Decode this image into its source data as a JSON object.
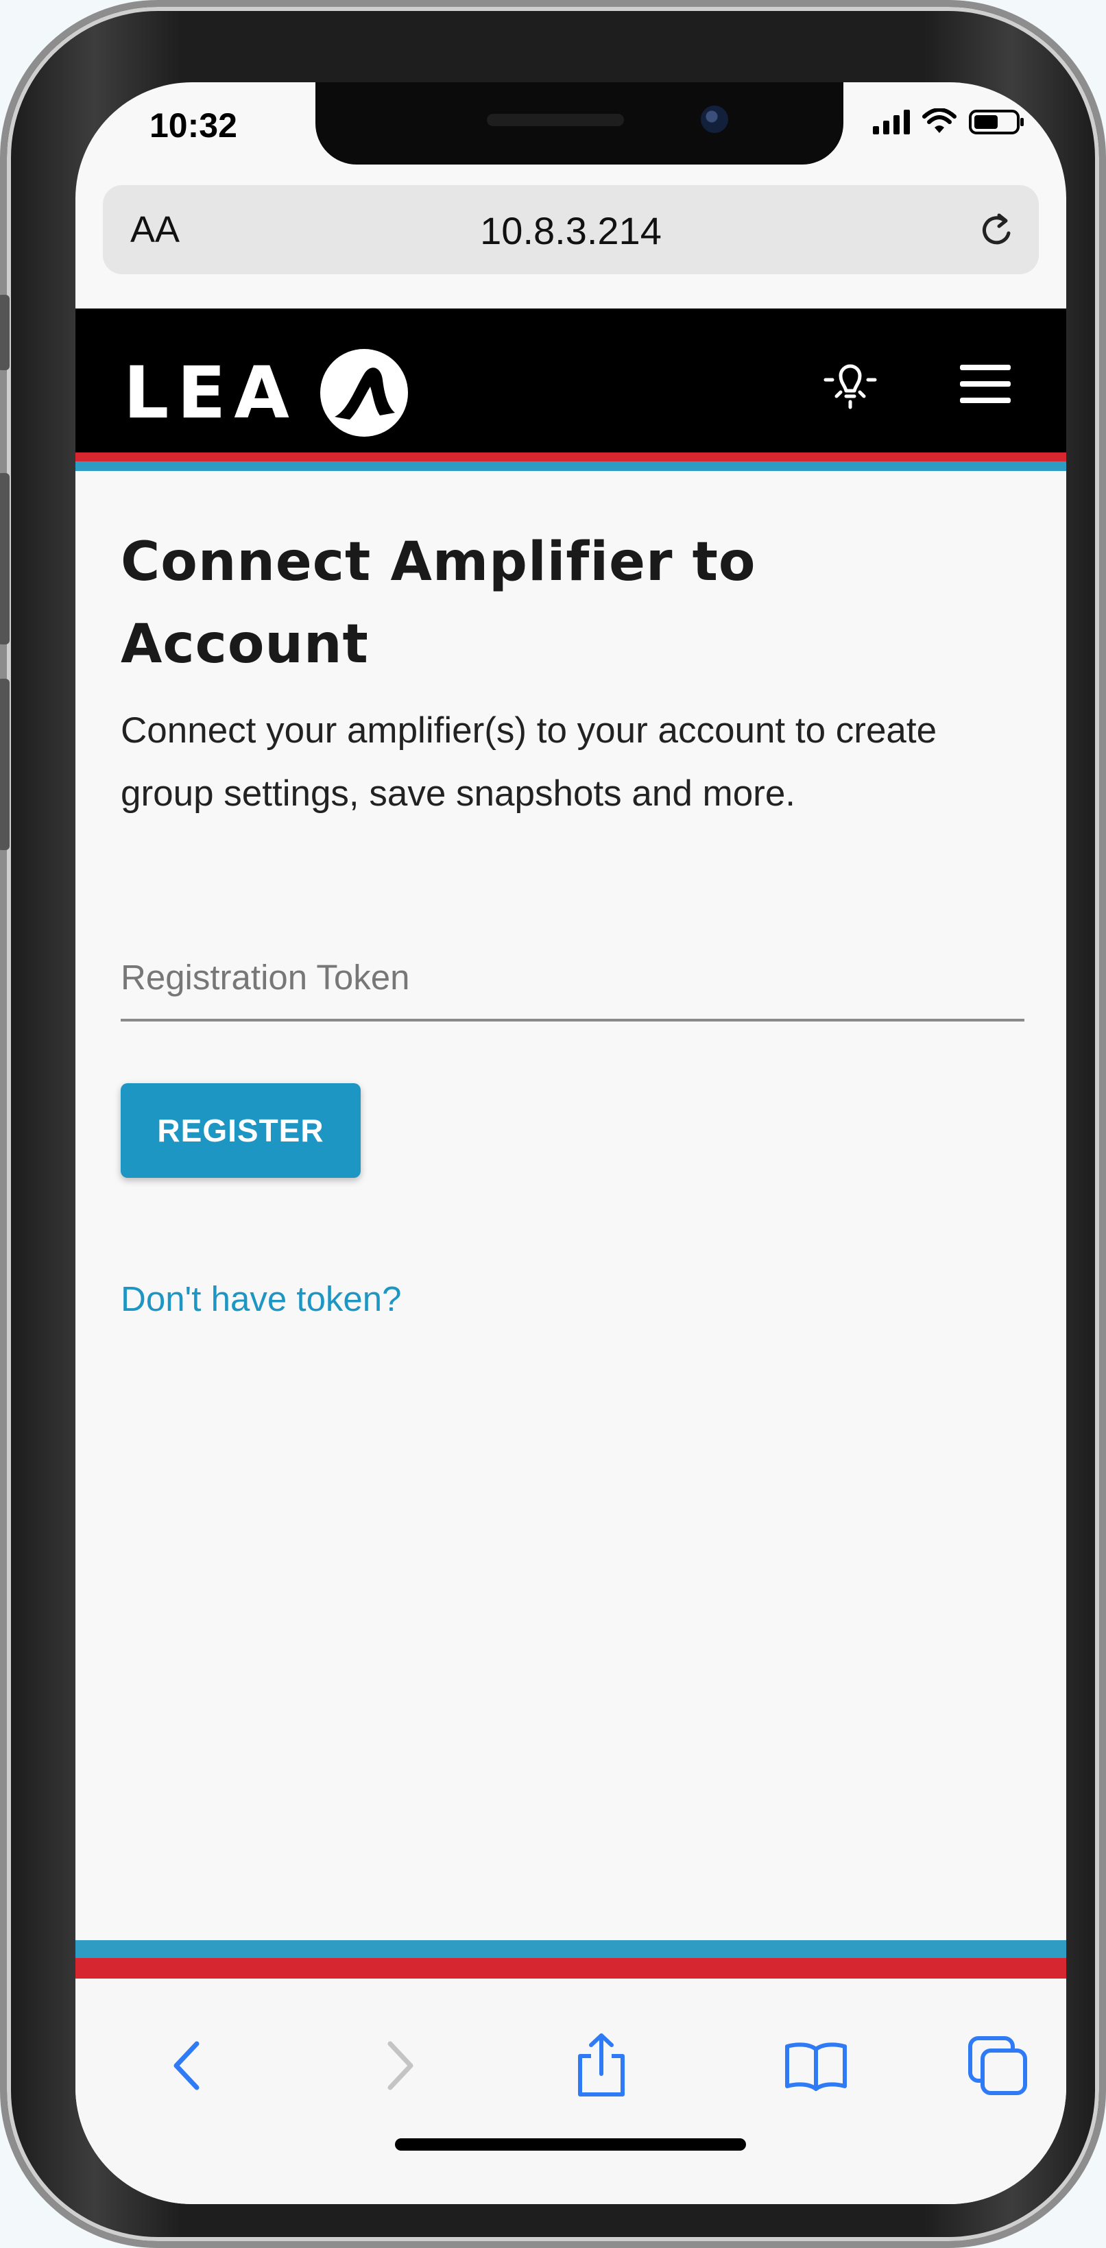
{
  "status_bar": {
    "time": "10:32",
    "icons": [
      "signal-icon",
      "wifi-icon",
      "battery-icon"
    ]
  },
  "browser": {
    "text_size_label": "AA",
    "address": "10.8.3.214",
    "reload_icon": "reload-icon"
  },
  "header": {
    "logo_text": "LEA",
    "logo_icon": "lea-logo-mark-icon",
    "bulb_icon": "lightbulb-icon",
    "menu_icon": "hamburger-menu-icon"
  },
  "main": {
    "title": "Connect Amplifier to Account",
    "description": "Connect your amplifier(s) to your account to create group settings, save snapshots and more.",
    "token_placeholder": "Registration Token",
    "token_value": "",
    "register_label": "REGISTER",
    "token_link": "Don't have token?"
  },
  "toolbar": {
    "items": [
      "back-icon",
      "forward-icon",
      "share-icon",
      "bookmarks-icon",
      "tabs-icon"
    ]
  },
  "colors": {
    "accent_blue": "#1e96c4",
    "stripe_red": "#d62730",
    "stripe_blue": "#2f9cc4",
    "header_bg": "#000000",
    "ios_blue": "#2f7bf6"
  }
}
